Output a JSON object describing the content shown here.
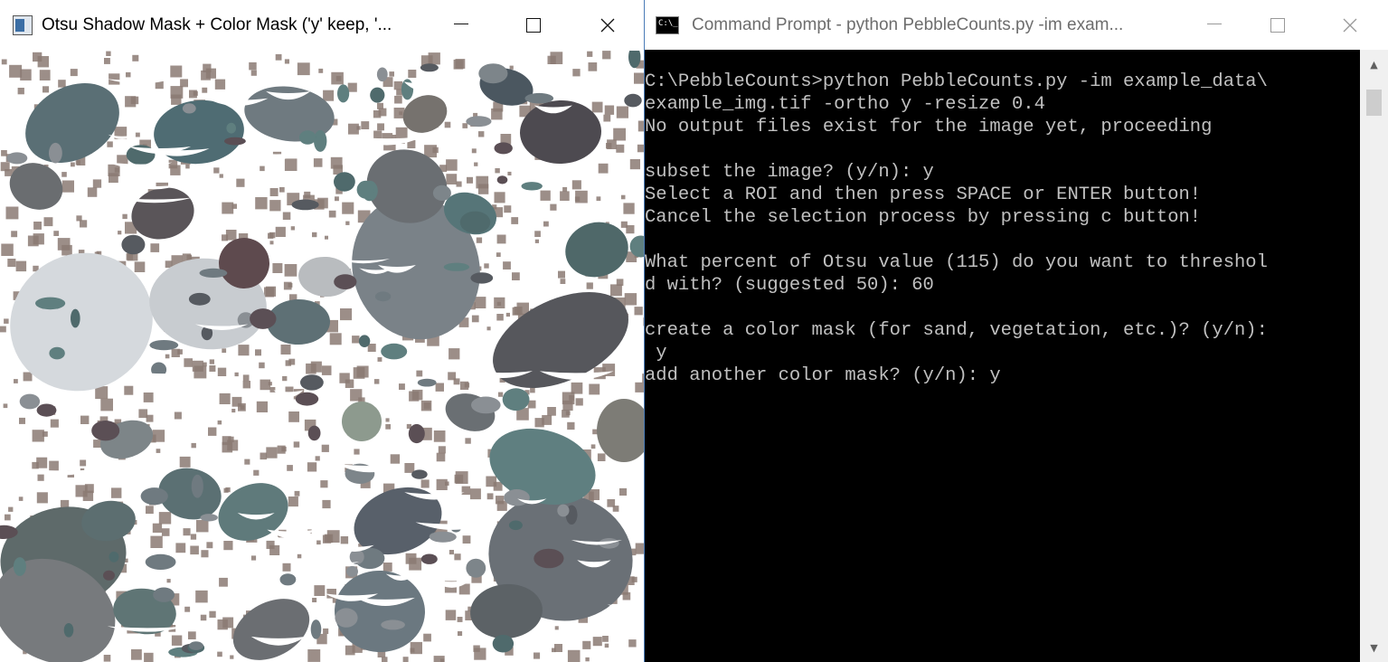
{
  "left_window": {
    "title": "Otsu Shadow Mask + Color Mask ('y' keep, '...",
    "minimize": "—",
    "maximize": "☐",
    "close": "✕",
    "icon": "image-window-icon",
    "image_description_colors": {
      "mask": "#ffffff",
      "sand": "#8b7a73",
      "pebble_gray": "#6f7a80",
      "pebble_teal": "#5f7f7f",
      "pebble_light": "#c8ccd0"
    }
  },
  "right_window": {
    "title": "Command Prompt - python  PebbleCounts.py -im exam...",
    "icon": "cmd-icon",
    "minimize": "—",
    "maximize": "☐",
    "close": "✕",
    "console_color": "#c0c0c0",
    "console_lines": [
      "C:\\PebbleCounts>python PebbleCounts.py -im example_data\\",
      "example_img.tif -ortho y -resize 0.4",
      "No output files exist for the image yet, proceeding",
      "",
      "subset the image? (y/n): y",
      "Select a ROI and then press SPACE or ENTER button!",
      "Cancel the selection process by pressing c button!",
      "",
      "What percent of Otsu value (115) do you want to threshol",
      "d with? (suggested 50): 60",
      "",
      "create a color mask (for sand, vegetation, etc.)? (y/n):",
      " y",
      "add another color mask? (y/n): y"
    ],
    "scroll_up": "▲",
    "scroll_down": "▼"
  }
}
